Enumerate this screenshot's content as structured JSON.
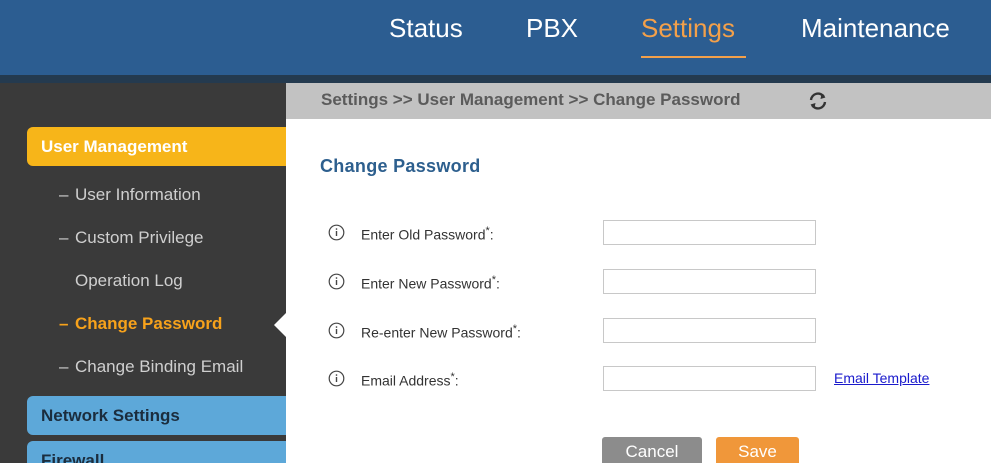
{
  "topnav": {
    "items": [
      {
        "label": "Status"
      },
      {
        "label": "PBX"
      },
      {
        "label": "Settings",
        "active": true
      },
      {
        "label": "Maintenance"
      }
    ]
  },
  "sidebar": {
    "sections": [
      {
        "label": "User Management",
        "state": "expanded"
      },
      {
        "label": "Network Settings"
      },
      {
        "label": "Firewall"
      }
    ],
    "sub_items": [
      {
        "dash": "–",
        "label": "User Information"
      },
      {
        "dash": "–",
        "label": "Custom Privilege"
      },
      {
        "dash": "",
        "label": "Operation Log"
      },
      {
        "dash": "–",
        "label": "Change Password",
        "active": true
      },
      {
        "dash": "–",
        "label": "Change Binding Email"
      }
    ]
  },
  "breadcrumb": {
    "text": "Settings >> User Management >> Change Password",
    "refresh_icon": "refresh-icon"
  },
  "form": {
    "title": "Change Password",
    "fields": [
      {
        "label": "Enter Old Password",
        "required_mark": "*",
        "suffix": ":",
        "value": "",
        "icon": "info-icon"
      },
      {
        "label": "Enter New Password",
        "required_mark": "*",
        "suffix": ":",
        "value": "",
        "icon": "info-icon"
      },
      {
        "label": "Re-enter New Password",
        "required_mark": "*",
        "suffix": ":",
        "value": "",
        "icon": "info-icon"
      },
      {
        "label": "Email Address",
        "required_mark": "*",
        "suffix": ":",
        "value": "",
        "icon": "info-icon"
      }
    ],
    "email_template_link": "Email Template",
    "cancel_label": "Cancel",
    "save_label": "Save"
  },
  "colors": {
    "topbar": "#2c5d91",
    "accent_orange": "#f7b519",
    "active_link": "#f7a21b",
    "sidebar_bg": "#3a3a3a",
    "section_blue": "#5da8d9",
    "title_blue": "#2d5f8e"
  }
}
